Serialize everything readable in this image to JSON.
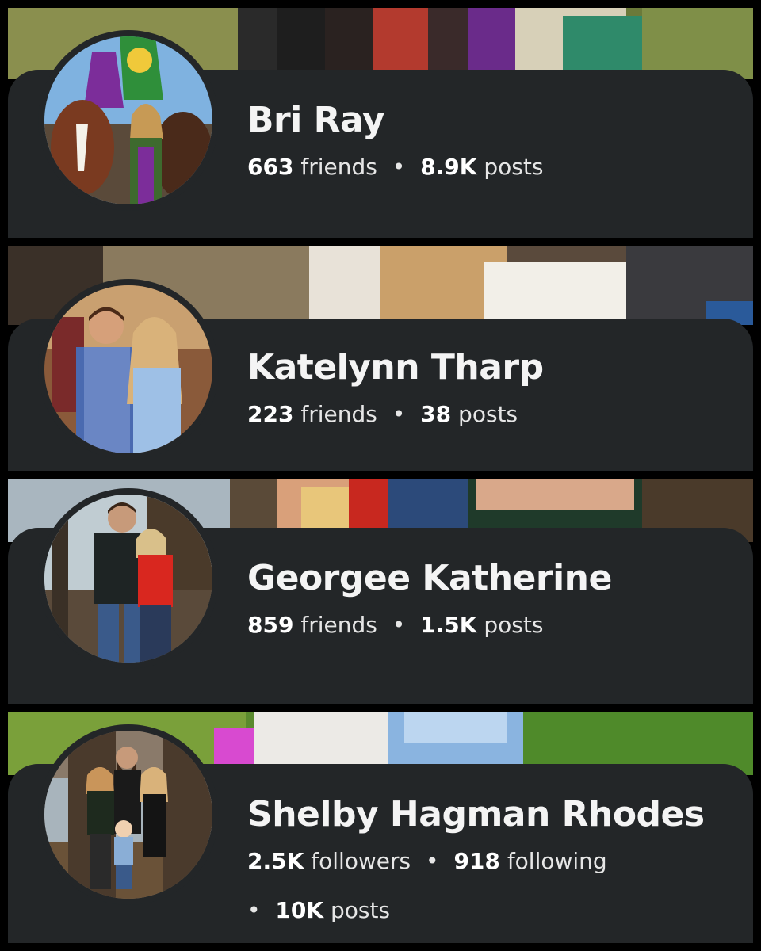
{
  "colors": {
    "panel": "#232628",
    "name_text": "#f4f4f4",
    "stat_text": "#e6e6e6"
  },
  "profiles": [
    {
      "name": "Bri Ray",
      "stats": [
        {
          "value": "663",
          "label": "friends"
        },
        {
          "value": "8.9K",
          "label": "posts"
        }
      ]
    },
    {
      "name": "Katelynn Tharp",
      "stats": [
        {
          "value": "223",
          "label": "friends"
        },
        {
          "value": "38",
          "label": "posts"
        }
      ]
    },
    {
      "name": "Georgee Katherine",
      "stats": [
        {
          "value": "859",
          "label": "friends"
        },
        {
          "value": "1.5K",
          "label": "posts"
        }
      ]
    },
    {
      "name": "Shelby Hagman Rhodes",
      "stats": [
        {
          "value": "2.5K",
          "label": "followers"
        },
        {
          "value": "918",
          "label": "following"
        },
        {
          "value": "10K",
          "label": "posts"
        }
      ]
    }
  ],
  "separator": "•"
}
